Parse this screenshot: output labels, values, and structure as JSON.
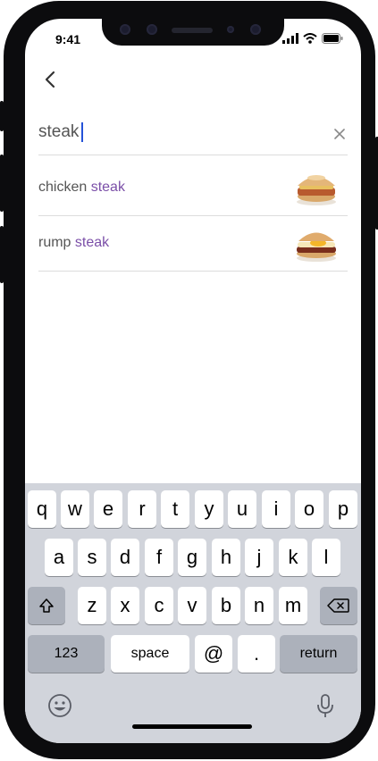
{
  "status": {
    "time": "9:41"
  },
  "search": {
    "query": "steak"
  },
  "suggestions": [
    {
      "prefix": "chicken ",
      "match": "steak"
    },
    {
      "prefix": "rump ",
      "match": "steak"
    }
  ],
  "keyboard": {
    "row1": [
      "q",
      "w",
      "e",
      "r",
      "t",
      "y",
      "u",
      "i",
      "o",
      "p"
    ],
    "row2": [
      "a",
      "s",
      "d",
      "f",
      "g",
      "h",
      "j",
      "k",
      "l"
    ],
    "row3": [
      "z",
      "x",
      "c",
      "v",
      "b",
      "n",
      "m"
    ],
    "numbers_label": "123",
    "space_label": "space",
    "at_label": "@",
    "dot_label": ".",
    "return_label": "return"
  },
  "colors": {
    "highlight": "#7b4fa8",
    "caret": "#2553d8",
    "keyboard_bg": "#d1d4db"
  },
  "icons": [
    "back-chevron-icon",
    "clear-x-icon",
    "shift-icon",
    "backspace-icon",
    "emoji-icon",
    "microphone-icon",
    "signal-icon",
    "wifi-icon",
    "battery-icon"
  ]
}
